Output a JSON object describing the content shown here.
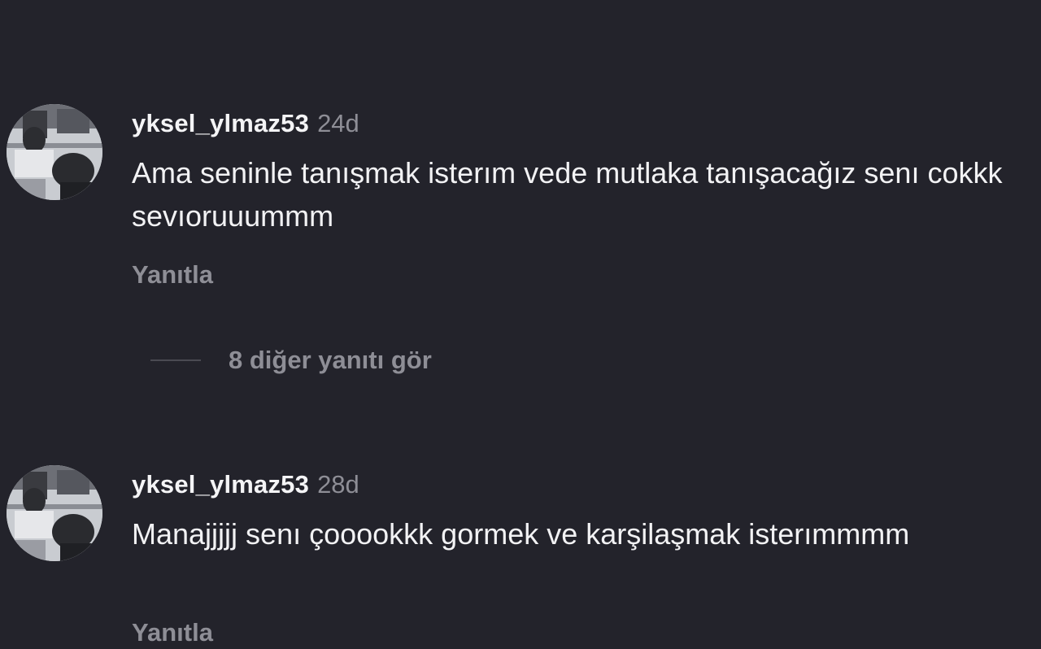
{
  "comments": [
    {
      "username": "yksel_ylmaz53",
      "time": "24d",
      "text": "Ama seninle tanışmak isterım vede mutlaka tanışacağız senı cokkk sevıoruuummm",
      "reply_label": "Yanıtla",
      "avatar_icon": "user-photo"
    },
    {
      "username": "yksel_ylmaz53",
      "time": "28d",
      "text": "Manajjjjj senı çooookkk gormek ve karşilaşmak isterımmmm",
      "reply_label": "Yanıtla",
      "avatar_icon": "user-photo"
    }
  ],
  "more_replies": {
    "label": "8 diğer yanıtı gör"
  },
  "colors": {
    "background": "#23232b",
    "text_primary": "#f2f2f4",
    "text_secondary": "#8e8e96"
  }
}
